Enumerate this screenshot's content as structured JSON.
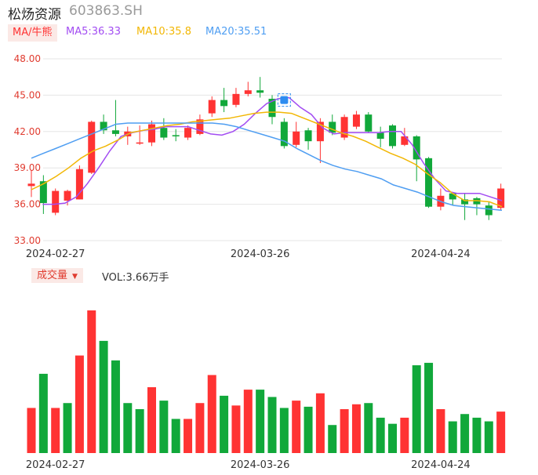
{
  "header": {
    "name": "松炀资源",
    "code": "603863.SH",
    "ma_label": "MA/牛熊",
    "ma5": "MA5:36.33",
    "ma10": "MA10:35.8",
    "ma20": "MA20:35.51",
    "vol_label": "成交量",
    "vol_text": "VOL:3.66万手"
  },
  "colors": {
    "up": "#ff3333",
    "down": "#11a83a",
    "ma5": "#a24cf2",
    "ma10": "#f2b705",
    "ma20": "#4f9ef2",
    "grid": "#e6e6e6"
  },
  "chart_data": [
    {
      "type": "candlestick",
      "x_tick_labels": [
        "2024-02-27",
        "2024-03-26",
        "2024-04-24"
      ],
      "x_tick_index": [
        2,
        19,
        34
      ],
      "y_tick_labels": [
        "48.00",
        "45.00",
        "42.00",
        "39.00",
        "36.00",
        "33.00"
      ],
      "ylim": [
        33,
        48
      ],
      "grid": true,
      "candles": [
        {
          "o": 37.5,
          "c": 37.7,
          "h": 38.8,
          "l": 36.6
        },
        {
          "o": 37.9,
          "c": 36.1,
          "h": 38.4,
          "l": 35.2
        },
        {
          "o": 35.3,
          "c": 37.1,
          "h": 37.3,
          "l": 35.1
        },
        {
          "o": 36.3,
          "c": 37.1,
          "h": 37.2,
          "l": 35.9
        },
        {
          "o": 36.4,
          "c": 38.9,
          "h": 39.2,
          "l": 36.4
        },
        {
          "o": 38.6,
          "c": 42.8,
          "h": 42.9,
          "l": 38.5
        },
        {
          "o": 42.8,
          "c": 42.1,
          "h": 43.4,
          "l": 41.8
        },
        {
          "o": 42.1,
          "c": 41.8,
          "h": 44.6,
          "l": 41.6
        },
        {
          "o": 41.6,
          "c": 42.0,
          "h": 42.4,
          "l": 40.9
        },
        {
          "o": 41.0,
          "c": 41.1,
          "h": 42.5,
          "l": 40.9
        },
        {
          "o": 41.1,
          "c": 42.6,
          "h": 42.9,
          "l": 40.8
        },
        {
          "o": 42.3,
          "c": 41.5,
          "h": 43.1,
          "l": 41.3
        },
        {
          "o": 41.7,
          "c": 41.6,
          "h": 42.2,
          "l": 41.2
        },
        {
          "o": 41.5,
          "c": 42.3,
          "h": 42.5,
          "l": 41.3
        },
        {
          "o": 41.8,
          "c": 43.0,
          "h": 43.4,
          "l": 41.7
        },
        {
          "o": 43.5,
          "c": 44.6,
          "h": 44.9,
          "l": 43.2
        },
        {
          "o": 44.6,
          "c": 44.1,
          "h": 45.6,
          "l": 43.6
        },
        {
          "o": 44.2,
          "c": 45.1,
          "h": 45.6,
          "l": 44.0
        },
        {
          "o": 45.1,
          "c": 45.4,
          "h": 46.1,
          "l": 44.9
        },
        {
          "o": 45.4,
          "c": 45.2,
          "h": 46.5,
          "l": 44.8
        },
        {
          "o": 44.7,
          "c": 43.2,
          "h": 45.0,
          "l": 42.6
        },
        {
          "o": 42.8,
          "c": 40.8,
          "h": 43.1,
          "l": 40.6
        },
        {
          "o": 40.9,
          "c": 42.0,
          "h": 42.8,
          "l": 40.7
        },
        {
          "o": 42.1,
          "c": 41.2,
          "h": 42.3,
          "l": 40.5
        },
        {
          "o": 41.2,
          "c": 42.8,
          "h": 43.1,
          "l": 39.4
        },
        {
          "o": 42.8,
          "c": 41.9,
          "h": 43.4,
          "l": 41.7
        },
        {
          "o": 41.5,
          "c": 43.2,
          "h": 43.4,
          "l": 41.3
        },
        {
          "o": 42.4,
          "c": 43.4,
          "h": 43.7,
          "l": 42.2
        },
        {
          "o": 43.4,
          "c": 42.0,
          "h": 43.6,
          "l": 41.9
        },
        {
          "o": 41.9,
          "c": 41.4,
          "h": 42.4,
          "l": 40.7
        },
        {
          "o": 42.5,
          "c": 40.8,
          "h": 42.6,
          "l": 40.6
        },
        {
          "o": 40.9,
          "c": 41.6,
          "h": 42.3,
          "l": 40.8
        },
        {
          "o": 41.6,
          "c": 39.7,
          "h": 41.7,
          "l": 37.9
        },
        {
          "o": 39.8,
          "c": 35.8,
          "h": 39.9,
          "l": 35.7
        },
        {
          "o": 35.8,
          "c": 36.7,
          "h": 37.3,
          "l": 35.5
        },
        {
          "o": 36.9,
          "c": 36.4,
          "h": 36.9,
          "l": 35.9
        },
        {
          "o": 36.4,
          "c": 36.0,
          "h": 36.9,
          "l": 34.7
        },
        {
          "o": 36.5,
          "c": 36.0,
          "h": 36.6,
          "l": 35.1
        },
        {
          "o": 35.9,
          "c": 35.1,
          "h": 36.2,
          "l": 34.7
        },
        {
          "o": 35.7,
          "c": 37.3,
          "h": 37.7,
          "l": 35.5
        }
      ],
      "series": [
        {
          "name": "MA5",
          "values": [
            null,
            36.0,
            36.0,
            36.1,
            36.6,
            37.7,
            39.0,
            40.4,
            41.6,
            41.9,
            42.1,
            42.2,
            42.4,
            42.4,
            42.4,
            42.1,
            41.8,
            41.7,
            42.0,
            42.6,
            43.5,
            44.3,
            44.7,
            44.8,
            44.0,
            43.4,
            42.3,
            41.8,
            41.9,
            41.9,
            41.9,
            41.9,
            42.0,
            42.0,
            40.9,
            39.4,
            38.1,
            37.1,
            36.9,
            36.9,
            36.9,
            36.6,
            36.3
          ]
        },
        {
          "name": "MA10",
          "values": [
            37.2,
            37.7,
            38.3,
            39.0,
            39.8,
            40.4,
            40.8,
            41.3,
            41.9,
            42.1,
            42.3,
            42.5,
            42.6,
            42.8,
            42.9,
            43.0,
            43.1,
            43.3,
            43.5,
            43.6,
            43.6,
            43.5,
            43.1,
            42.7,
            42.3,
            41.9,
            41.6,
            41.2,
            40.7,
            40.2,
            39.8,
            39.3,
            38.5,
            37.8,
            36.9,
            36.3,
            36.3,
            36.2,
            35.8
          ]
        },
        {
          "name": "MA20",
          "values": [
            39.8,
            40.2,
            40.6,
            41.0,
            41.4,
            41.8,
            42.2,
            42.6,
            42.7,
            42.7,
            42.7,
            42.7,
            42.7,
            42.7,
            42.7,
            42.7,
            42.6,
            42.4,
            42.1,
            41.8,
            41.5,
            41.2,
            40.6,
            40.1,
            39.6,
            39.2,
            38.9,
            38.7,
            38.4,
            38.1,
            37.6,
            37.3,
            37.0,
            36.6,
            36.2,
            35.9,
            35.8,
            35.7,
            35.6,
            35.5
          ]
        }
      ]
    },
    {
      "type": "bar",
      "title": "成交量",
      "x_tick_labels": [
        "2024-02-27",
        "2024-03-26",
        "2024-04-24"
      ],
      "x_tick_index": [
        2,
        19,
        34
      ],
      "values": [
        3.7,
        6.5,
        3.7,
        4.1,
        8.0,
        11.7,
        9.2,
        7.6,
        4.1,
        3.6,
        5.4,
        4.3,
        2.8,
        2.8,
        4.1,
        6.4,
        4.7,
        3.9,
        5.2,
        5.2,
        4.6,
        3.7,
        4.3,
        3.8,
        4.9,
        2.3,
        3.6,
        4.0,
        4.1,
        2.9,
        2.4,
        2.9,
        7.2,
        7.4,
        3.6,
        2.6,
        3.2,
        2.9,
        2.6,
        3.4
      ],
      "up": [
        true,
        false,
        true,
        false,
        true,
        true,
        false,
        false,
        false,
        false,
        true,
        false,
        false,
        true,
        true,
        true,
        false,
        true,
        true,
        false,
        false,
        false,
        true,
        false,
        true,
        false,
        true,
        true,
        false,
        false,
        false,
        true,
        false,
        false,
        true,
        false,
        false,
        false,
        false,
        true
      ]
    }
  ]
}
